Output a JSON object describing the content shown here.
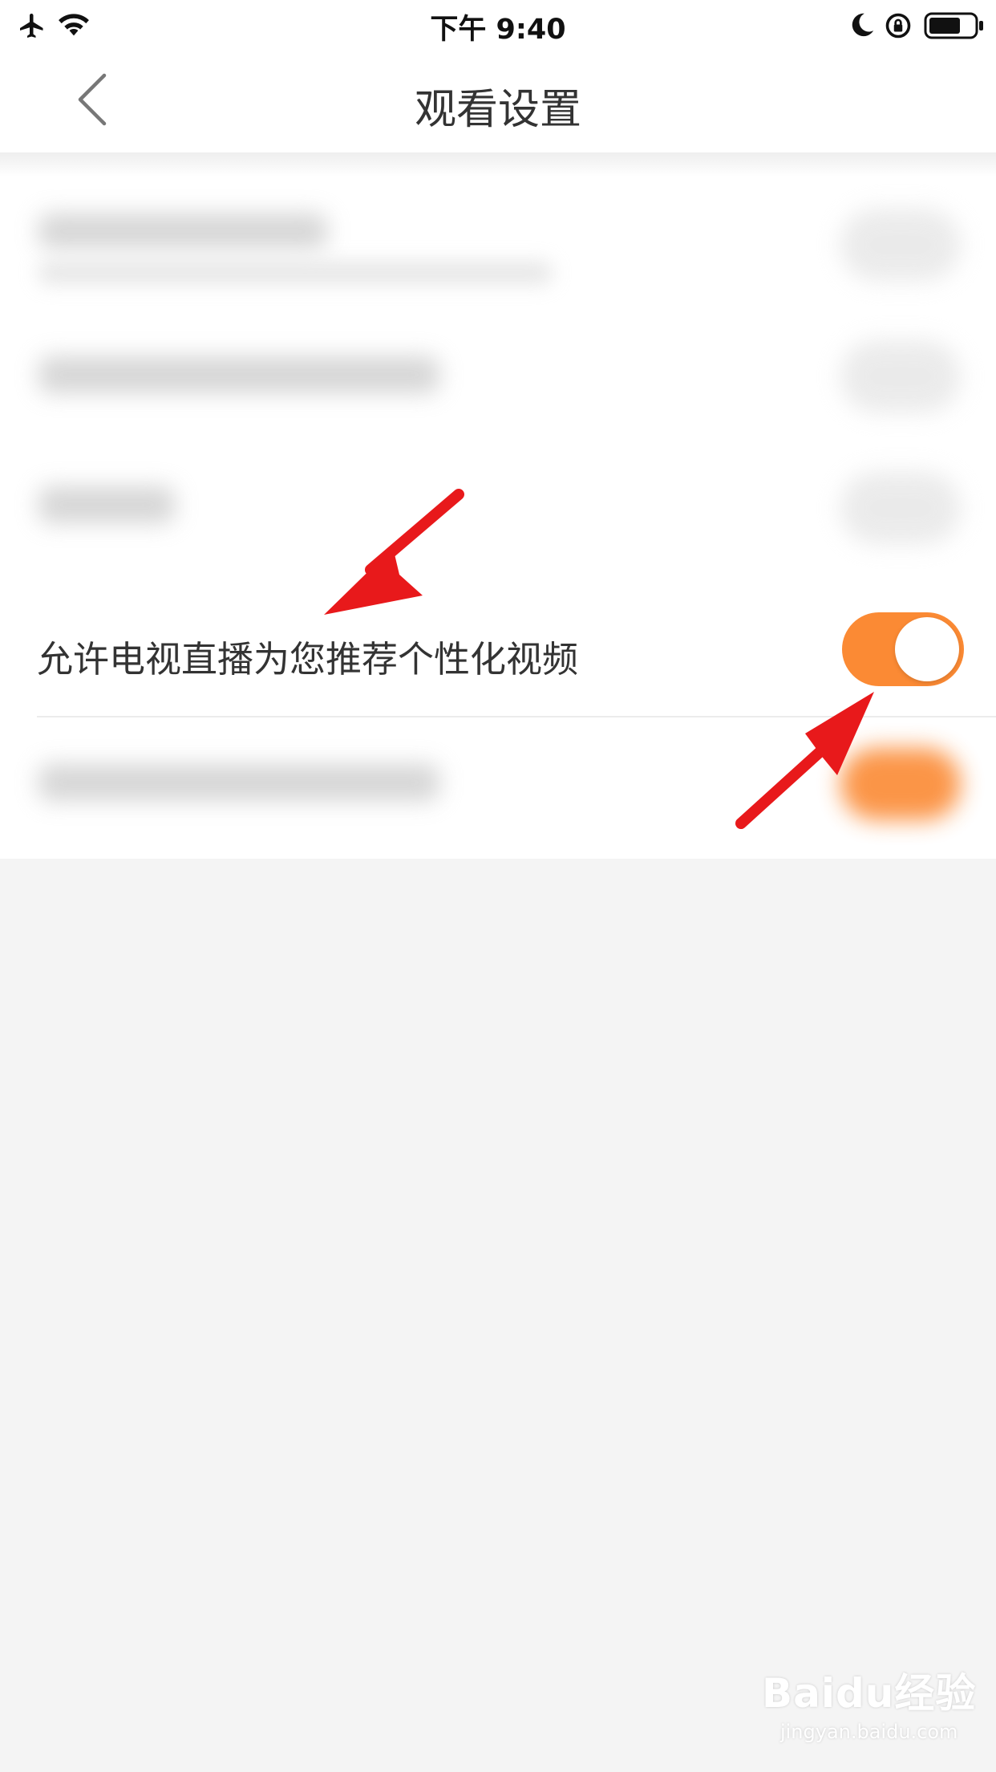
{
  "status_bar": {
    "time": "下午 9:40",
    "icons": [
      "airplane-icon",
      "wifi-icon",
      "moon-icon",
      "rotation-lock-icon",
      "battery-icon"
    ]
  },
  "nav": {
    "title": "观看设置",
    "back_icon": "chevron-left-icon"
  },
  "settings": {
    "highlighted_item": {
      "label": "允许电视直播为您推荐个性化视频",
      "toggle_on": true
    }
  },
  "colors": {
    "accent": "#fb8a34",
    "annotation_arrow": "#e8191b",
    "background": "#f4f4f4"
  },
  "watermark": {
    "logo": "Baidu经验",
    "url": "jingyan.baidu.com"
  }
}
